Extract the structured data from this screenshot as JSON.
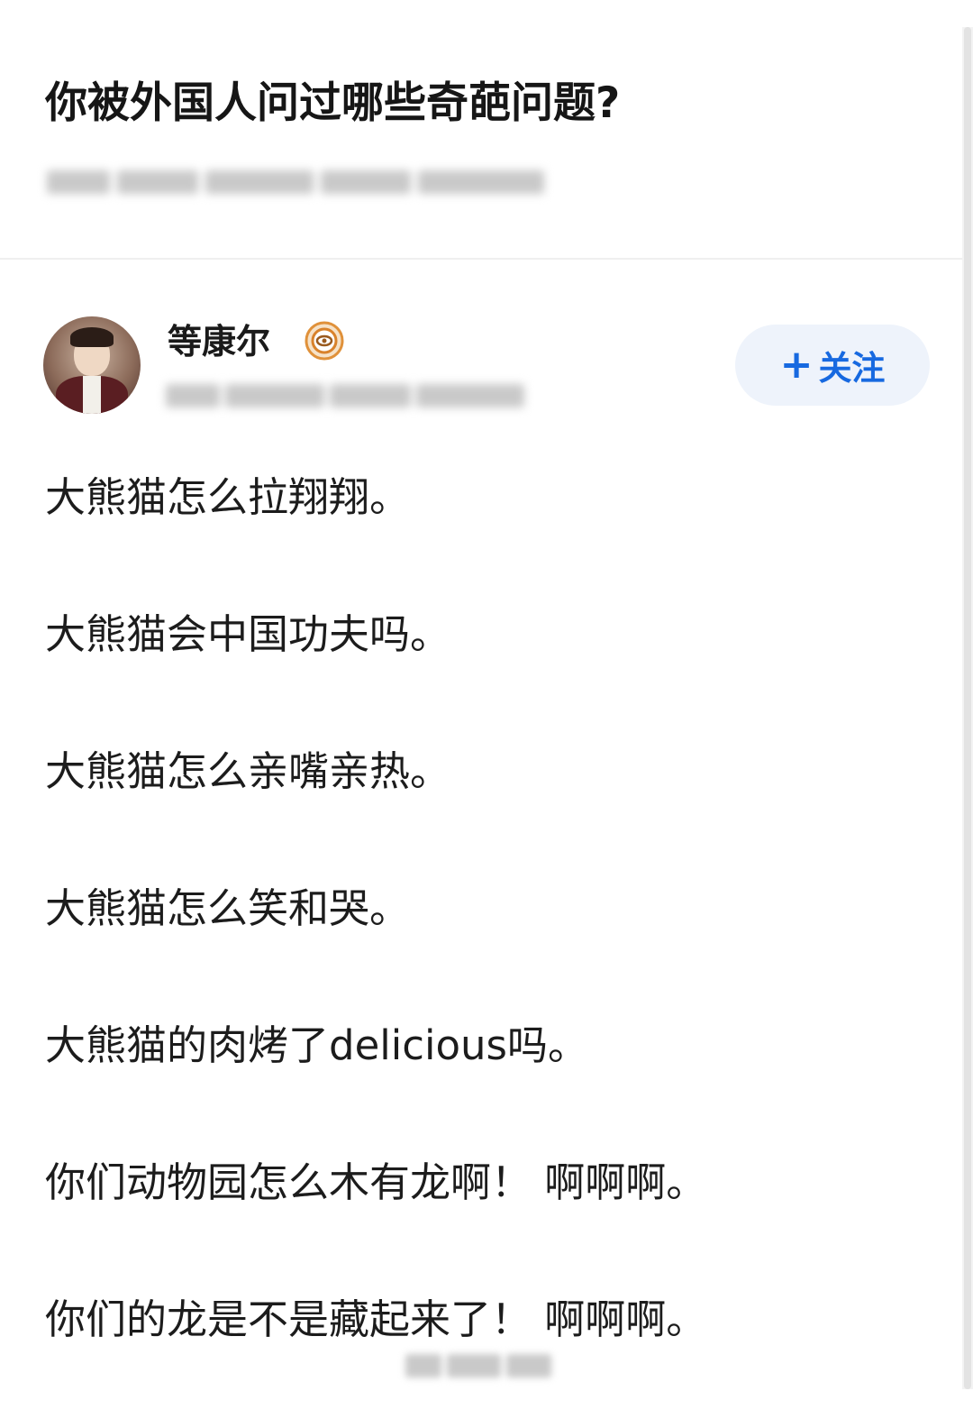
{
  "question": {
    "title": "你被外国人问过哪些奇葩问题?"
  },
  "author": {
    "name": "等康尔",
    "badge_icon": "certified-badge-icon",
    "follow_button_label": "关注",
    "follow_button_icon": "plus-icon"
  },
  "answer": {
    "lines": [
      "大熊猫怎么拉翔翔。",
      "大熊猫会中国功夫吗。",
      "大熊猫怎么亲嘴亲热。",
      "大熊猫怎么笑和哭。",
      "大熊猫的肉烤了delicious吗。",
      "你们动物园怎么木有龙啊！ 啊啊啊。",
      "你们的龙是不是藏起来了！ 啊啊啊。"
    ]
  },
  "colors": {
    "accent": "#1769e0",
    "follow_bg": "#eef3fb",
    "text": "#1c1c1c",
    "badge": "#e0913a"
  }
}
